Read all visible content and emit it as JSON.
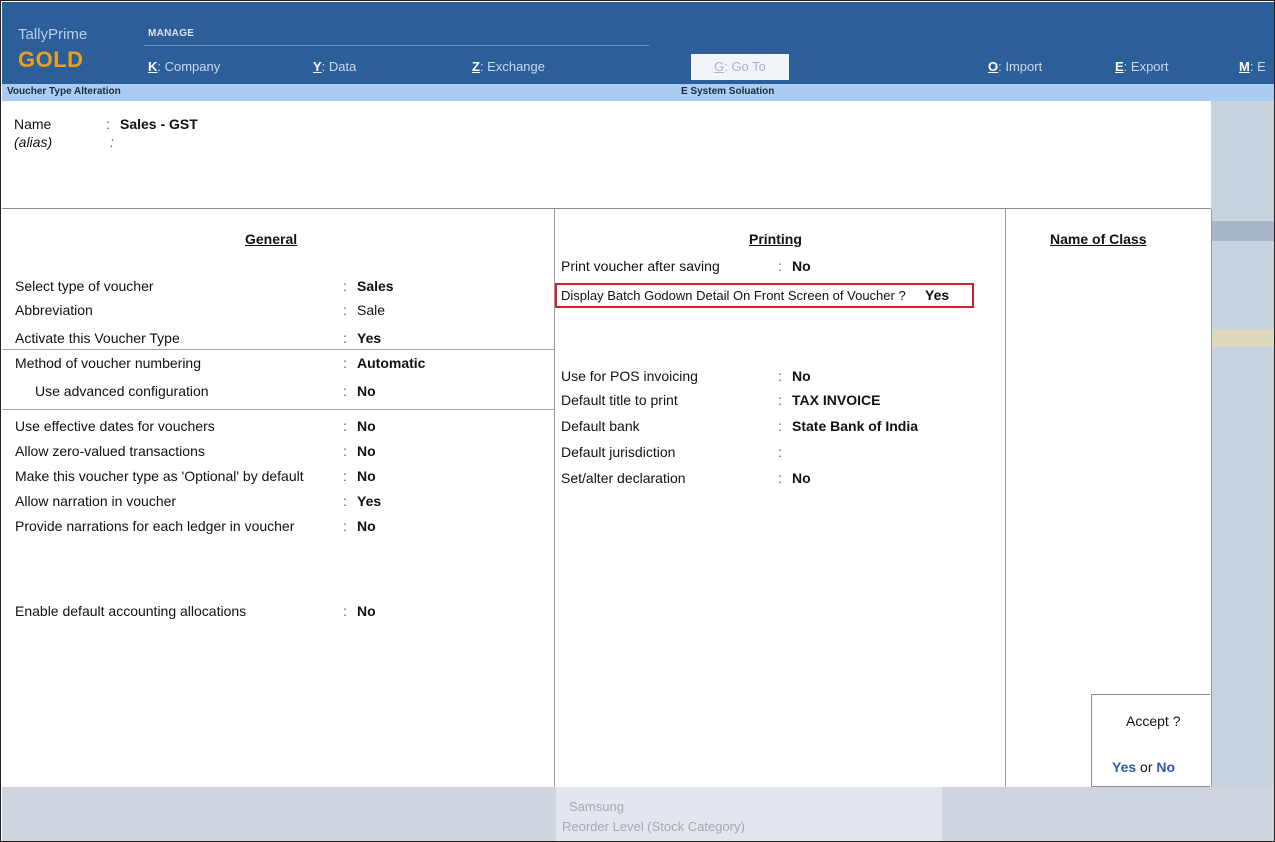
{
  "app": {
    "name": "TallyPrime",
    "edition": "GOLD"
  },
  "topbar": {
    "section_label": "MANAGE",
    "menu": [
      {
        "key": "K",
        "label": ": Company"
      },
      {
        "key": "Y",
        "label": ": Data"
      },
      {
        "key": "Z",
        "label": ": Exchange"
      },
      {
        "key": "G",
        "label": ": Go To"
      },
      {
        "key": "O",
        "label": ": Import"
      },
      {
        "key": "E",
        "label": ": Export"
      },
      {
        "key": "M",
        "label": ": E"
      }
    ]
  },
  "subtitle": {
    "screen": "Voucher Type Alteration",
    "company": "E System Soluation"
  },
  "header": {
    "name_label": "Name",
    "name_value": "Sales - GST",
    "alias_label": "(alias)",
    "alias_value": ""
  },
  "general": {
    "title": "General",
    "rows": [
      {
        "label": "Select type of voucher",
        "value": "Sales",
        "bold": true
      },
      {
        "label": "Abbreviation",
        "value": "Sale",
        "bold": false
      },
      {
        "label": "Activate this Voucher Type",
        "value": "Yes",
        "bold": true
      },
      {
        "label": "Method of voucher numbering",
        "value": "Automatic",
        "bold": true
      },
      {
        "label": "Use advanced configuration",
        "value": "No",
        "bold": true
      },
      {
        "label": "Use effective dates for vouchers",
        "value": "No",
        "bold": true
      },
      {
        "label": "Allow zero-valued transactions",
        "value": "No",
        "bold": true
      },
      {
        "label": "Make this voucher type as 'Optional' by default",
        "value": "No",
        "bold": true
      },
      {
        "label": "Allow narration in voucher",
        "value": "Yes",
        "bold": true
      },
      {
        "label": "Provide narrations for each ledger in voucher",
        "value": "No",
        "bold": true
      },
      {
        "label": "Enable default accounting allocations",
        "value": "No",
        "bold": true
      }
    ]
  },
  "printing": {
    "title": "Printing",
    "print_after_saving": {
      "label": "Print voucher after saving",
      "value": "No"
    },
    "display_batch": {
      "label": "Display Batch Godown Detail On Front Screen of Voucher ?",
      "value": "Yes"
    },
    "rows": [
      {
        "label": "Use for POS invoicing",
        "value": "No"
      },
      {
        "label": "Default title to print",
        "value": "TAX INVOICE"
      },
      {
        "label": "Default bank",
        "value": "State Bank of India"
      },
      {
        "label": "Default jurisdiction",
        "value": ""
      },
      {
        "label": "Set/alter declaration",
        "value": "No"
      }
    ]
  },
  "class_panel": {
    "title": "Name of Class"
  },
  "accept": {
    "question": "Accept ?",
    "yes": "Yes",
    "or": "or",
    "no": "No"
  },
  "background_text": [
    "Samsung",
    "Reorder Level (Stock Category)"
  ],
  "colors": {
    "topbar": "#2c5f9a",
    "subtitle_bar": "#a9cdf0",
    "edition": "#e8a020",
    "highlight_border": "#d0202a",
    "accept_option": "#2a5bb0"
  }
}
